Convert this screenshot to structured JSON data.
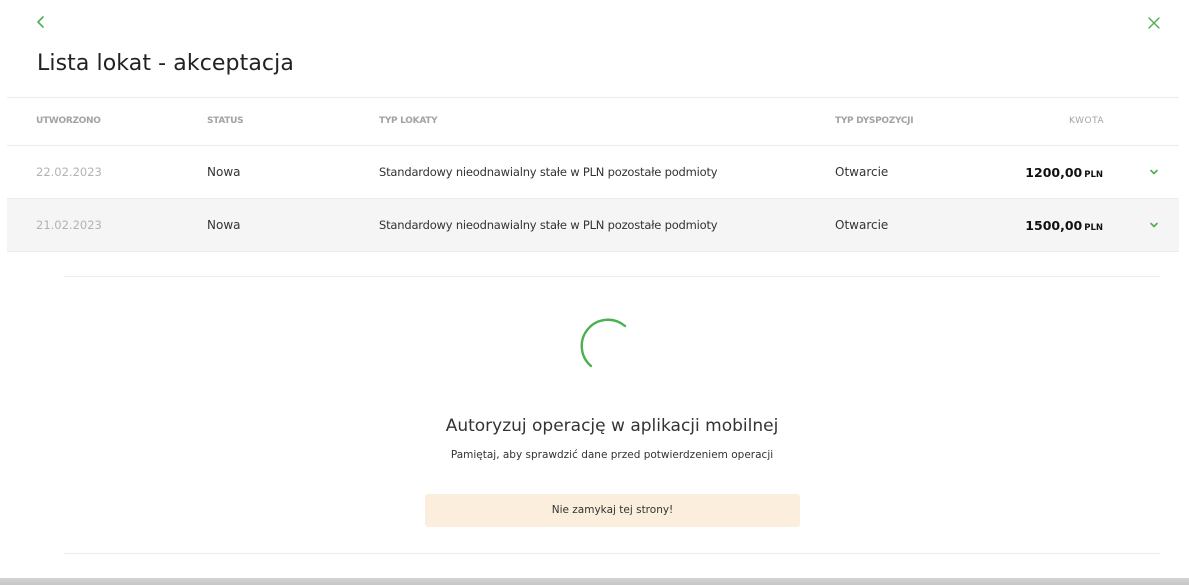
{
  "header": {
    "title": "Lista lokat - akceptacja",
    "back_icon": "chevron-left-icon",
    "close_icon": "close-icon",
    "accent_color": "#4caf50"
  },
  "table": {
    "columns": {
      "created": "UTWORZONO",
      "status": "STATUS",
      "type": "TYP LOKATY",
      "disposition": "TYP DYSPOZYCJI",
      "amount": "KWOTA"
    },
    "rows": [
      {
        "created": "22.02.2023",
        "status": "Nowa",
        "type": "Standardowy nieodnawialny stałe w PLN pozostałe podmioty",
        "disposition": "Otwarcie",
        "amount": "1200,00",
        "currency": "PLN"
      },
      {
        "created": "21.02.2023",
        "status": "Nowa",
        "type": "Standardowy nieodnawialny stałe w PLN pozostałe podmioty",
        "disposition": "Otwarcie",
        "amount": "1500,00",
        "currency": "PLN"
      }
    ]
  },
  "auth": {
    "spinner_icon": "loading-spinner-icon",
    "title": "Autoryzuj operację w aplikacji mobilnej",
    "subtitle": "Pamiętaj, aby sprawdzić dane przed potwierdzeniem operacji",
    "warning": "Nie zamykaj tej strony!",
    "warning_color": "#fbeedd"
  }
}
